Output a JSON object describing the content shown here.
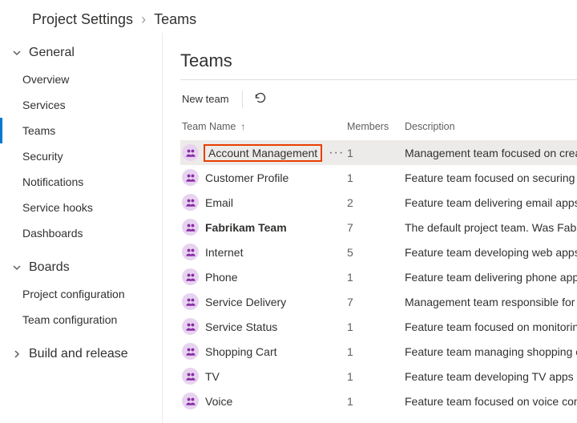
{
  "breadcrumb": {
    "parent": "Project Settings",
    "current": "Teams"
  },
  "sidebar": {
    "groups": [
      {
        "label": "General",
        "expanded": true,
        "items": [
          {
            "label": "Overview"
          },
          {
            "label": "Services"
          },
          {
            "label": "Teams",
            "active": true
          },
          {
            "label": "Security"
          },
          {
            "label": "Notifications"
          },
          {
            "label": "Service hooks"
          },
          {
            "label": "Dashboards"
          }
        ]
      },
      {
        "label": "Boards",
        "expanded": true,
        "items": [
          {
            "label": "Project configuration"
          },
          {
            "label": "Team configuration"
          }
        ]
      },
      {
        "label": "Build and release",
        "expanded": false,
        "items": []
      }
    ]
  },
  "page_title": "Teams",
  "toolbar": {
    "new_team": "New team"
  },
  "table": {
    "headers": {
      "name": "Team Name",
      "members": "Members",
      "description": "Description"
    },
    "sort_indicator": "↑",
    "rows": [
      {
        "name": "Account Management",
        "members": "1",
        "description": "Management team focused on creating an",
        "selected": true,
        "highlight": true
      },
      {
        "name": "Customer Profile",
        "members": "1",
        "description": "Feature team focused on securing account"
      },
      {
        "name": "Email",
        "members": "2",
        "description": "Feature team delivering email apps"
      },
      {
        "name": "Fabrikam Team",
        "members": "7",
        "description": "The default project team. Was Fabrikam Fi",
        "bold": true
      },
      {
        "name": "Internet",
        "members": "5",
        "description": "Feature team developing web apps"
      },
      {
        "name": "Phone",
        "members": "1",
        "description": "Feature team delivering phone apps"
      },
      {
        "name": "Service Delivery",
        "members": "7",
        "description": "Management team responsible for ensure"
      },
      {
        "name": "Service Status",
        "members": "1",
        "description": "Feature team focused on monitoring and a"
      },
      {
        "name": "Shopping Cart",
        "members": "1",
        "description": "Feature team managing shopping cart app"
      },
      {
        "name": "TV",
        "members": "1",
        "description": "Feature team developing TV apps"
      },
      {
        "name": "Voice",
        "members": "1",
        "description": "Feature team focused on voice communica"
      }
    ]
  },
  "colors": {
    "avatar_fg": "#8a2da5",
    "avatar_bg": "#e7d3f0"
  }
}
